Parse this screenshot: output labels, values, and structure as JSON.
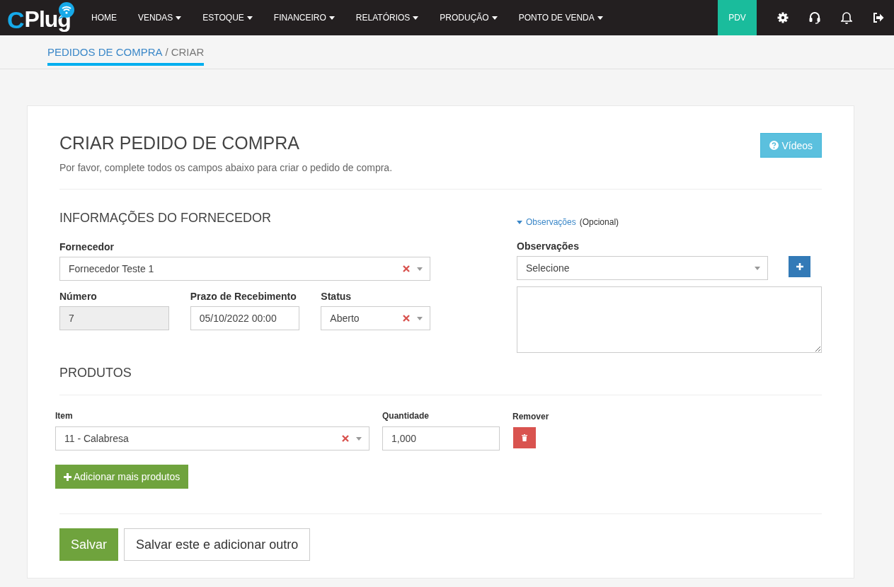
{
  "navbar": {
    "logo_prefix": "C",
    "logo_text": "Plug",
    "items": [
      {
        "label": "HOME",
        "has_menu": false
      },
      {
        "label": "VENDAS",
        "has_menu": true
      },
      {
        "label": "ESTOQUE",
        "has_menu": true
      },
      {
        "label": "FINANCEIRO",
        "has_menu": true
      },
      {
        "label": "RELATÓRIOS",
        "has_menu": true
      },
      {
        "label": "PRODUÇÃO",
        "has_menu": true
      },
      {
        "label": "PONTO DE VENDA",
        "has_menu": true
      }
    ],
    "pdv_button": "PDV"
  },
  "breadcrumb": {
    "parent": "PEDIDOS DE COMPRA",
    "separator": "/",
    "current": "CRIAR"
  },
  "form": {
    "title": "CRIAR PEDIDO DE COMPRA",
    "subtitle": "Por favor, complete todos os campos abaixo para criar o pedido de compra.",
    "videos_button": "Vídeos",
    "supplier_section": {
      "heading": "INFORMAÇÕES DO FORNECEDOR",
      "supplier": {
        "label": "Fornecedor",
        "value": "Fornecedor Teste 1",
        "clearable": true
      },
      "fields": [
        {
          "kind": "input",
          "label": "Número",
          "value": "7",
          "disabled": true
        },
        {
          "kind": "input",
          "label": "Prazo de Recebimento",
          "value": "05/10/2022 00:00",
          "disabled": false
        },
        {
          "kind": "select",
          "label": "Status",
          "value": "Aberto",
          "clearable": true
        }
      ]
    },
    "notes_section": {
      "toggle": "Observações",
      "toggle_note": "(Opcional)",
      "expanded": true,
      "label": "Observações",
      "select_value": "Selecione",
      "clearable": false
    },
    "products": {
      "heading": "PRODUTOS",
      "item_label": "Item",
      "quantity_label": "Quantidade",
      "remove_label": "Remover",
      "rows": [
        {
          "item": "11 - Calabresa",
          "quantity": "1,000",
          "clearable": true
        }
      ],
      "add_button": "Adicionar mais produtos"
    },
    "save_button": "Salvar",
    "save_and_add_button": "Salvar este e adicionar outro"
  }
}
